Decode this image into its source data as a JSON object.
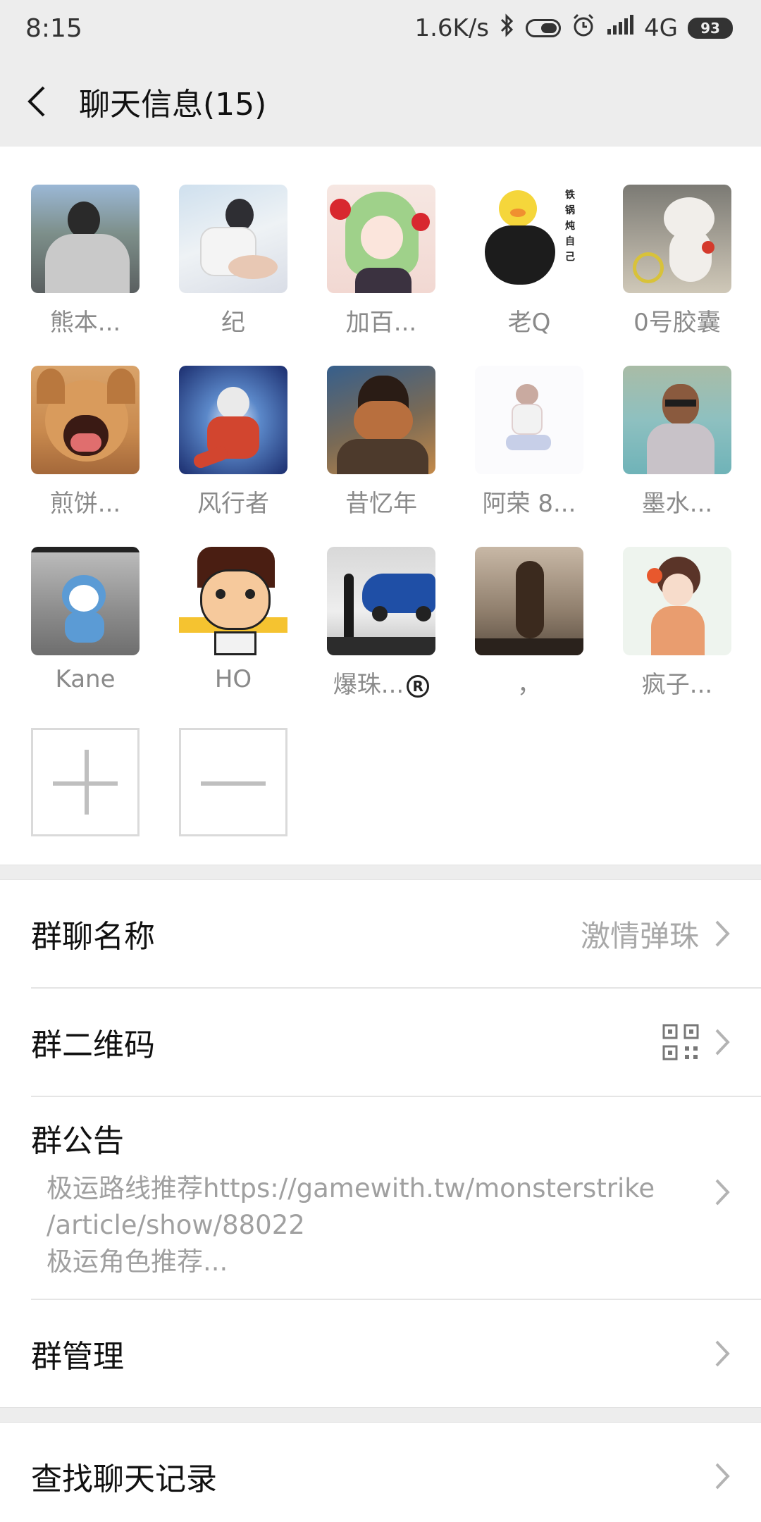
{
  "status": {
    "time": "8:15",
    "speed": "1.6K/s",
    "network": "4G",
    "battery": "93"
  },
  "header": {
    "title": "聊天信息(15)"
  },
  "members": [
    {
      "name": "熊本...",
      "avatar": "person-back-street"
    },
    {
      "name": "纪",
      "avatar": "hospital-photo"
    },
    {
      "name": "加百...",
      "avatar": "anime-girl-green-hair"
    },
    {
      "name": "老Q",
      "avatar": "duck-in-pot"
    },
    {
      "name": "0号胶囊",
      "avatar": "white-toy-figure"
    },
    {
      "name": "煎饼...",
      "avatar": "shiba-dog"
    },
    {
      "name": "风行者",
      "avatar": "anime-fighter"
    },
    {
      "name": "昔忆年",
      "avatar": "man-face-in-hands"
    },
    {
      "name": "阿荣 8...",
      "avatar": "sketch-boy-sitting"
    },
    {
      "name": "墨水...",
      "avatar": "man-at-lake"
    },
    {
      "name": "Kane",
      "avatar": "doraemon-city"
    },
    {
      "name": "HO",
      "avatar": "cartoon-boy-peace"
    },
    {
      "name": "爆珠...",
      "avatar": "car-silhouette"
    },
    {
      "name": "，",
      "avatar": "cockroach-photo"
    },
    {
      "name": "疯子...",
      "avatar": "anime-girl-flowers"
    }
  ],
  "settings": {
    "group_name_label": "群聊名称",
    "group_name_value": "激情弹珠",
    "qr_label": "群二维码",
    "notice_label": "群公告",
    "notice_line1": "极运路线推荐https://gamewith.tw/monsterstrike",
    "notice_line2": "/article/show/88022",
    "notice_line3": "极运角色推荐...",
    "manage_label": "群管理",
    "search_label": "查找聊天记录"
  },
  "colors": {
    "header_bg": "#ededed",
    "muted_text": "#8a8a8a"
  }
}
